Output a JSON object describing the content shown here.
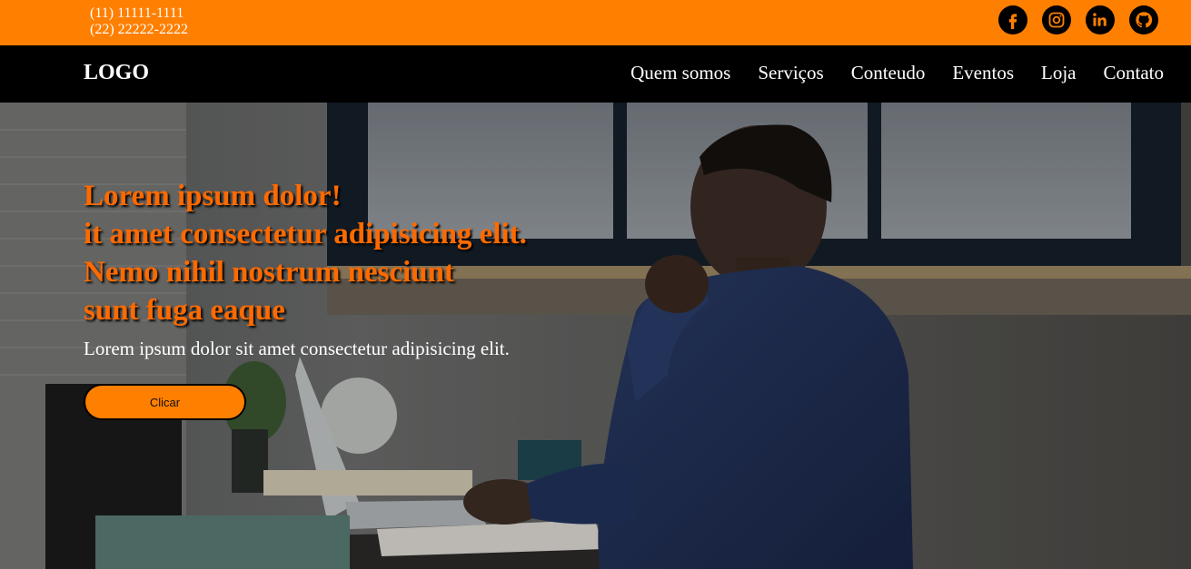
{
  "topbar": {
    "phones": [
      "(11) 11111-1111",
      "(22) 22222-2222"
    ],
    "socials": [
      {
        "icon": "facebook-icon"
      },
      {
        "icon": "instagram-icon"
      },
      {
        "icon": "linkedin-icon"
      },
      {
        "icon": "github-icon"
      }
    ],
    "background": "#ff7f00"
  },
  "navbar": {
    "logo": "LOGO",
    "items": [
      "Quem somos",
      "Serviços",
      "Conteudo",
      "Eventos",
      "Loja",
      "Contato"
    ]
  },
  "hero": {
    "headline": [
      "Lorem ipsum dolor!",
      "it amet consectetur adipisicing elit.",
      "Nemo nihil nostrum nesciunt",
      "sunt fuga eaque"
    ],
    "subtitle": "Lorem ipsum dolor sit amet consectetur adipisicing elit.",
    "button_label": "Clicar",
    "headline_color": "#ff6a00",
    "button_color": "#ff7f00"
  }
}
